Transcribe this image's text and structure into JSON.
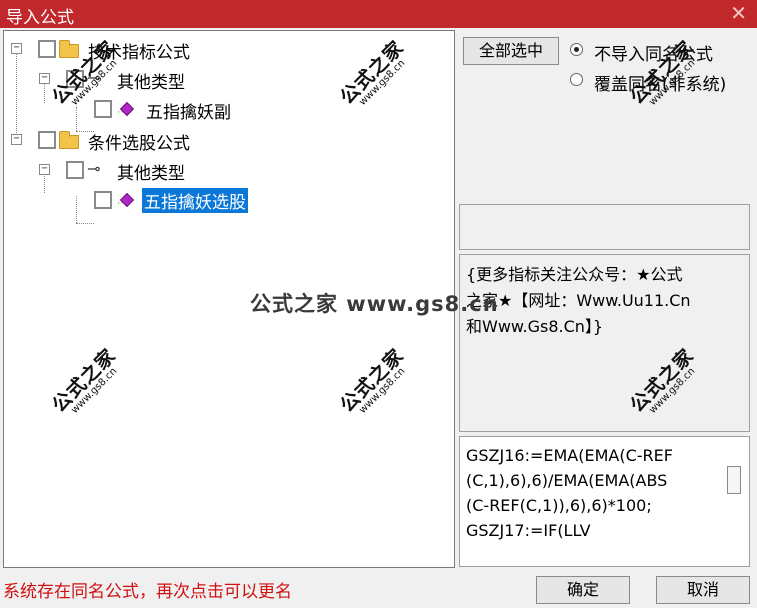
{
  "window": {
    "title": "导入公式",
    "close_glyph": "✕"
  },
  "tree": {
    "nodes": [
      {
        "label": "技术指标公式",
        "type": "folder",
        "expander": "−"
      },
      {
        "label": "其他类型",
        "type": "category",
        "expander": "−"
      },
      {
        "label": "五指擒妖副",
        "type": "formula"
      },
      {
        "label": "条件选股公式",
        "type": "folder",
        "expander": "−"
      },
      {
        "label": "其他类型",
        "type": "category",
        "expander": "−"
      },
      {
        "label": "五指擒妖选股",
        "type": "formula",
        "selected": true
      }
    ],
    "key_glyph": "⊸"
  },
  "buttons": {
    "select_all": "全部选中",
    "ok": "确定",
    "cancel": "取消"
  },
  "options": [
    {
      "label": "不导入同名公式",
      "selected": true
    },
    {
      "label": "覆盖同名(非系统)",
      "selected": false
    }
  ],
  "description_lines": [
    "{更多指标关注公众号：★公式",
    "之家★【网址：Www.Uu11.Cn",
    "和Www.Gs8.Cn】}"
  ],
  "code_lines": [
    "GSZJ16:=EMA(EMA(C-REF",
    "(C,1),6),6)/EMA(EMA(ABS",
    "(C-REF(C,1)),6),6)*100;",
    "GSZJ17:=IF(LLV"
  ],
  "status_message": "系统存在同名公式，再次点击可以更名",
  "watermark": {
    "name": "公式之家",
    "url": "www.gs8.cn",
    "banner": "公式之家 www.gs8.cn"
  },
  "colors": {
    "titlebar": "#c0282b",
    "selection": "#0b78d7",
    "status": "#d01010",
    "folder": "#f3c34a",
    "formula_gem": "#b227c7"
  }
}
